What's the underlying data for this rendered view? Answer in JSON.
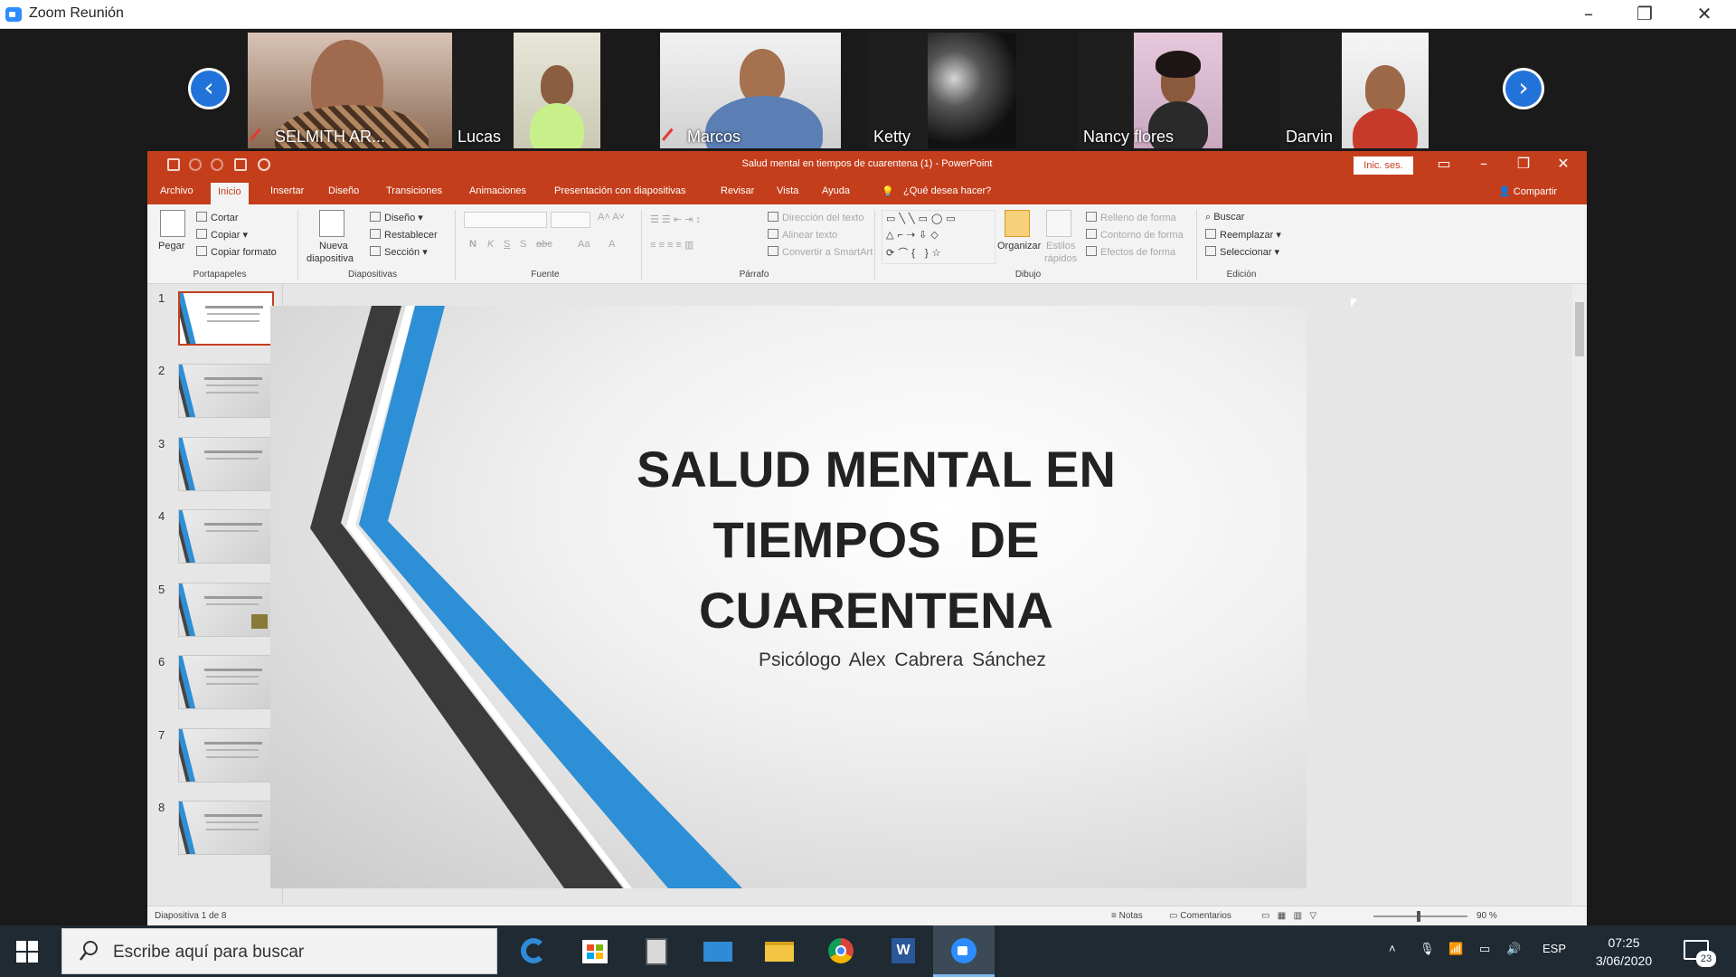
{
  "zoom": {
    "window_title": "Zoom Reunión",
    "participants": [
      {
        "name": "SELMITH AR...",
        "muted": true
      },
      {
        "name": "Lucas",
        "muted": false
      },
      {
        "name": "Marcos",
        "muted": true
      },
      {
        "name": "Ketty",
        "muted": false
      },
      {
        "name": "Nancy flores",
        "muted": false
      },
      {
        "name": "Darvin",
        "muted": false
      }
    ],
    "prev_arrow": "‹",
    "next_arrow": "›"
  },
  "powerpoint": {
    "title": "Salud mental en tiempos  de  cuarentena (1)  -  PowerPoint",
    "signin_label": "Inic. ses.",
    "tabs": [
      "Archivo",
      "Inicio",
      "Insertar",
      "Diseño",
      "Transiciones",
      "Animaciones",
      "Presentación con diapositivas",
      "Revisar",
      "Vista",
      "Ayuda"
    ],
    "active_tab": "Inicio",
    "tell_me": "¿Qué desea hacer?",
    "share": "Compartir",
    "ribbon": {
      "clipboard": {
        "label": "Portapapeles",
        "paste": "Pegar",
        "cut": "Cortar",
        "copy": "Copiar",
        "format_painter": "Copiar formato"
      },
      "slides": {
        "label": "Diapositivas",
        "new_slide_1": "Nueva",
        "new_slide_2": "diapositiva",
        "layout": "Diseño",
        "reset": "Restablecer",
        "section": "Sección"
      },
      "font": {
        "label": "Fuente",
        "bold": "N",
        "italic": "K",
        "underline": "S",
        "strike": "S",
        "abc": "abc",
        "aa": "Aa",
        "fontcolor": "A"
      },
      "paragraph": {
        "label": "Párrafo",
        "text_direction": "Dirección del texto",
        "align_text": "Alinear texto",
        "smartart": "Convertir a SmartArt"
      },
      "drawing": {
        "label": "Dibujo",
        "arrange": "Organizar",
        "quick_styles_1": "Estilos",
        "quick_styles_2": "rápidos",
        "shape_fill": "Relleno de forma",
        "shape_outline": "Contorno de forma",
        "shape_effects": "Efectos de forma"
      },
      "editing": {
        "label": "Edición",
        "find": "Buscar",
        "replace": "Reemplazar",
        "select": "Seleccionar"
      }
    },
    "thumbnails": [
      "1",
      "2",
      "3",
      "4",
      "5",
      "6",
      "7",
      "8"
    ],
    "selected_slide": 1,
    "slide": {
      "title_line1": "SALUD MENTAL EN",
      "title_line2": "TIEMPOS  DE",
      "title_line3": "CUARENTENA",
      "subtitle": "Psicólogo Alex Cabrera Sánchez"
    },
    "status": {
      "slide_count": "Diapositiva 1 de 8",
      "notes": "Notas",
      "comments": "Comentarios",
      "zoom": "90 %"
    }
  },
  "taskbar": {
    "search_placeholder": "Escribe aquí para buscar",
    "apps": [
      "edge-icon",
      "store-icon",
      "calculator-icon",
      "mail-icon",
      "file-explorer-icon",
      "chrome-icon",
      "word-icon",
      "zoom-icon"
    ],
    "language": "ESP",
    "time": "07:25",
    "date": "3/06/2020",
    "notifications": "23"
  },
  "colors": {
    "ppt_accent": "#c43e1c",
    "zoom_blue": "#2d8cff",
    "slide_blue": "#2d8fd5"
  }
}
